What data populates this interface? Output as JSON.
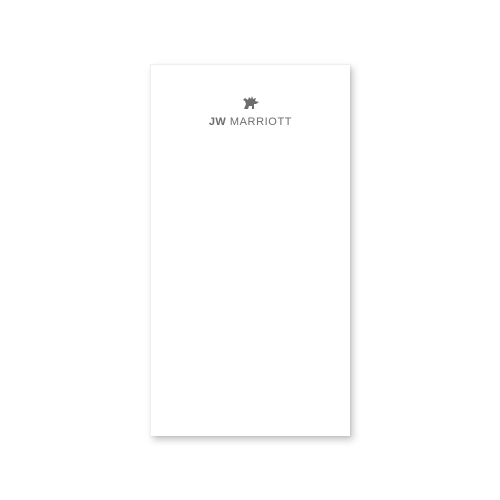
{
  "notepad": {
    "logo": {
      "jw": "JW",
      "brand": "MARRIOTT",
      "emblem_icon": "pegasus-emblem-icon",
      "color": "#6e6e6e"
    },
    "paper_color": "#ffffff"
  }
}
